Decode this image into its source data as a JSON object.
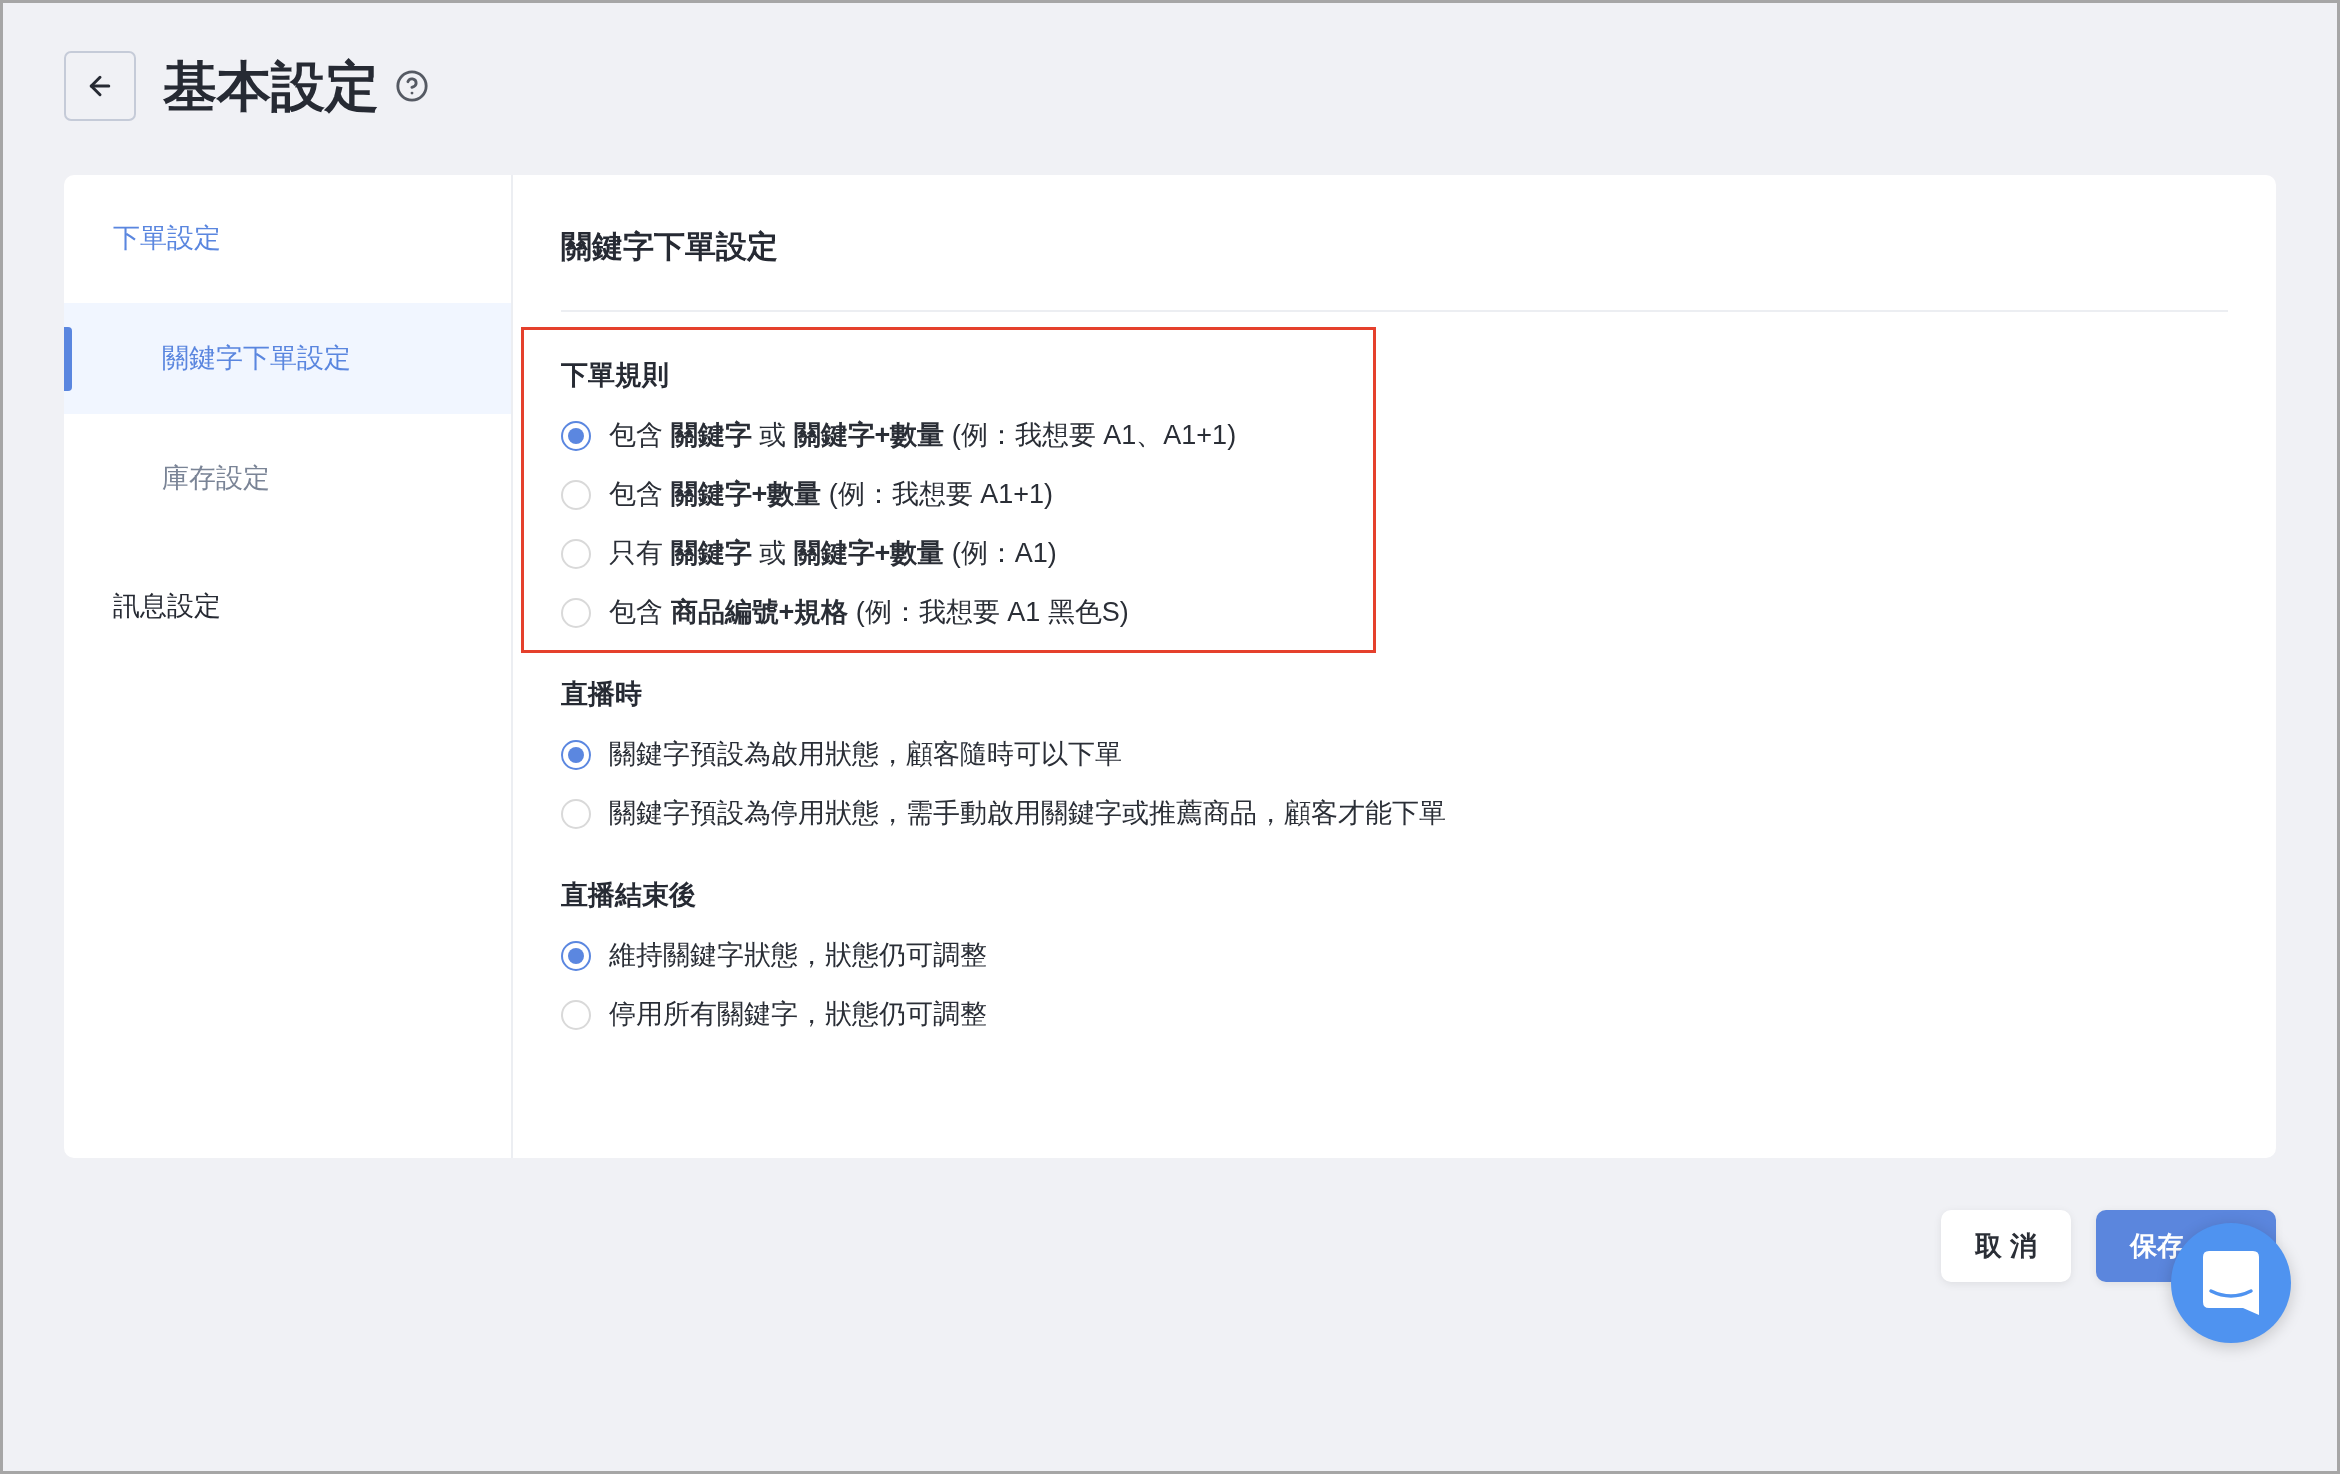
{
  "header": {
    "title": "基本設定"
  },
  "sidebar": {
    "groups": [
      {
        "label": "下單設定",
        "children": [
          {
            "label": "關鍵字下單設定",
            "selected": true
          },
          {
            "label": "庫存設定",
            "selected": false
          }
        ]
      },
      {
        "label": "訊息設定"
      }
    ]
  },
  "panel": {
    "title": "關鍵字下單設定",
    "sections": [
      {
        "title": "下單規則",
        "highlighted": true,
        "options": [
          {
            "label": "包含 **關鍵字** 或 **關鍵字+數量** (例：我想要 A1、A1+1)",
            "selected": true
          },
          {
            "label": "包含 **關鍵字+數量** (例：我想要 A1+1)",
            "selected": false
          },
          {
            "label": "只有 **關鍵字** 或 **關鍵字+數量** (例：A1)",
            "selected": false
          },
          {
            "label": "包含 **商品編號+規格** (例：我想要 A1 黑色S)",
            "selected": false
          }
        ]
      },
      {
        "title": "直播時",
        "highlighted": false,
        "options": [
          {
            "label": "關鍵字預設為啟用狀態，顧客隨時可以下單",
            "selected": true
          },
          {
            "label": "關鍵字預設為停用狀態，需手動啟用關鍵字或推薦商品，顧客才能下單",
            "selected": false
          }
        ]
      },
      {
        "title": "直播結束後",
        "highlighted": false,
        "options": [
          {
            "label": "維持關鍵字狀態，狀態仍可調整",
            "selected": true
          },
          {
            "label": "停用所有關鍵字，狀態仍可調整",
            "selected": false
          }
        ]
      }
    ]
  },
  "footer": {
    "buttons": [
      {
        "label": "取 消",
        "kind": "secondary"
      },
      {
        "label": "保存",
        "kind": "primary"
      }
    ]
  }
}
